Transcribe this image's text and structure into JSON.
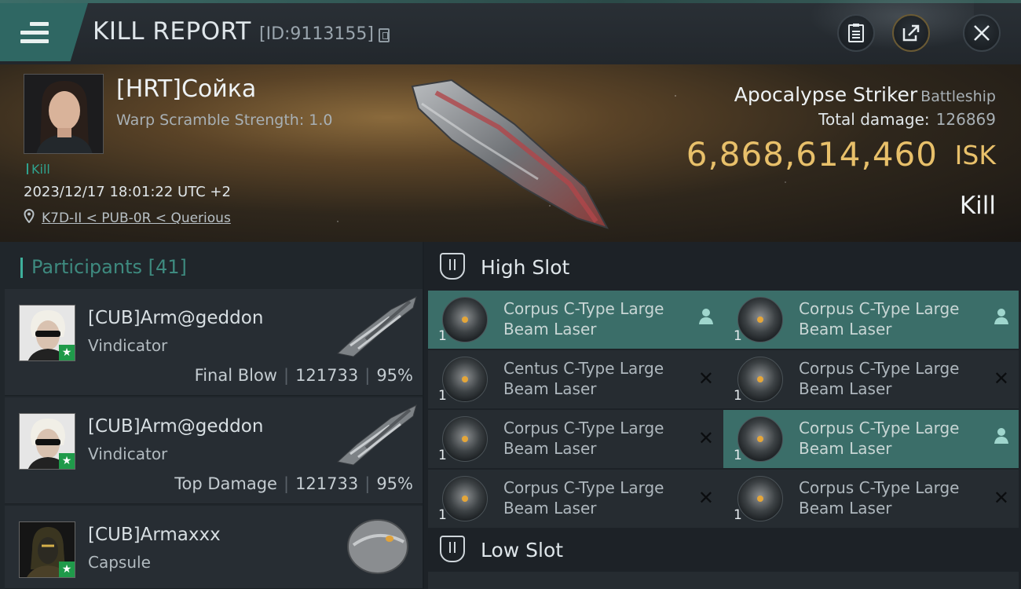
{
  "header": {
    "title": "KILL REPORT",
    "report_id": "[ID:9113155]"
  },
  "victim": {
    "pilot_name": "[HRT]Сойка",
    "warp_scramble": "Warp Scramble Strength: 1.0",
    "tag": "Kill",
    "datetime": "2023/12/17 18:01:22 UTC +2",
    "location": "K7D-II < PUB-0R < Querious",
    "ship_name": "Apocalypse Striker",
    "ship_class": "Battleship",
    "total_damage_label": "Total damage:",
    "total_damage": "126869",
    "isk_value": "6,868,614,460",
    "isk_unit": "ISK",
    "result": "Kill"
  },
  "participants": {
    "title": "Participants",
    "count": "[41]",
    "rows": [
      {
        "name": "[CUB]Arm@geddon",
        "ship": "Vindicator",
        "role": "Final Blow",
        "damage": "121733",
        "percent": "95%"
      },
      {
        "name": "[CUB]Arm@geddon",
        "ship": "Vindicator",
        "role": "Top Damage",
        "damage": "121733",
        "percent": "95%"
      },
      {
        "name": "[CUB]Armaxxx",
        "ship": "Capsule"
      }
    ]
  },
  "high_slot": {
    "title": "High Slot",
    "modules": [
      {
        "qty": "1",
        "name": "Corpus C-Type Large Beam Laser",
        "status": "user-icon",
        "highlighted": true
      },
      {
        "qty": "1",
        "name": "Corpus C-Type Large Beam Laser",
        "status": "user-icon",
        "highlighted": true
      },
      {
        "qty": "1",
        "name": "Centus C-Type Large Beam Laser",
        "status": "destroyed-icon",
        "highlighted": false
      },
      {
        "qty": "1",
        "name": "Corpus C-Type Large Beam Laser",
        "status": "destroyed-icon",
        "highlighted": false
      },
      {
        "qty": "1",
        "name": "Corpus C-Type Large Beam Laser",
        "status": "destroyed-icon",
        "highlighted": false
      },
      {
        "qty": "1",
        "name": "Corpus C-Type Large Beam Laser",
        "status": "user-icon",
        "highlighted": true
      },
      {
        "qty": "1",
        "name": "Corpus C-Type Large Beam Laser",
        "status": "destroyed-icon",
        "highlighted": false
      },
      {
        "qty": "1",
        "name": "Corpus C-Type Large Beam Laser",
        "status": "destroyed-icon",
        "highlighted": false
      }
    ]
  },
  "low_slot": {
    "title": "Low Slot"
  },
  "colors": {
    "accent_teal": "#3b6e69",
    "isk_gold": "#e8c06a",
    "kill_green": "#2fa38f"
  }
}
